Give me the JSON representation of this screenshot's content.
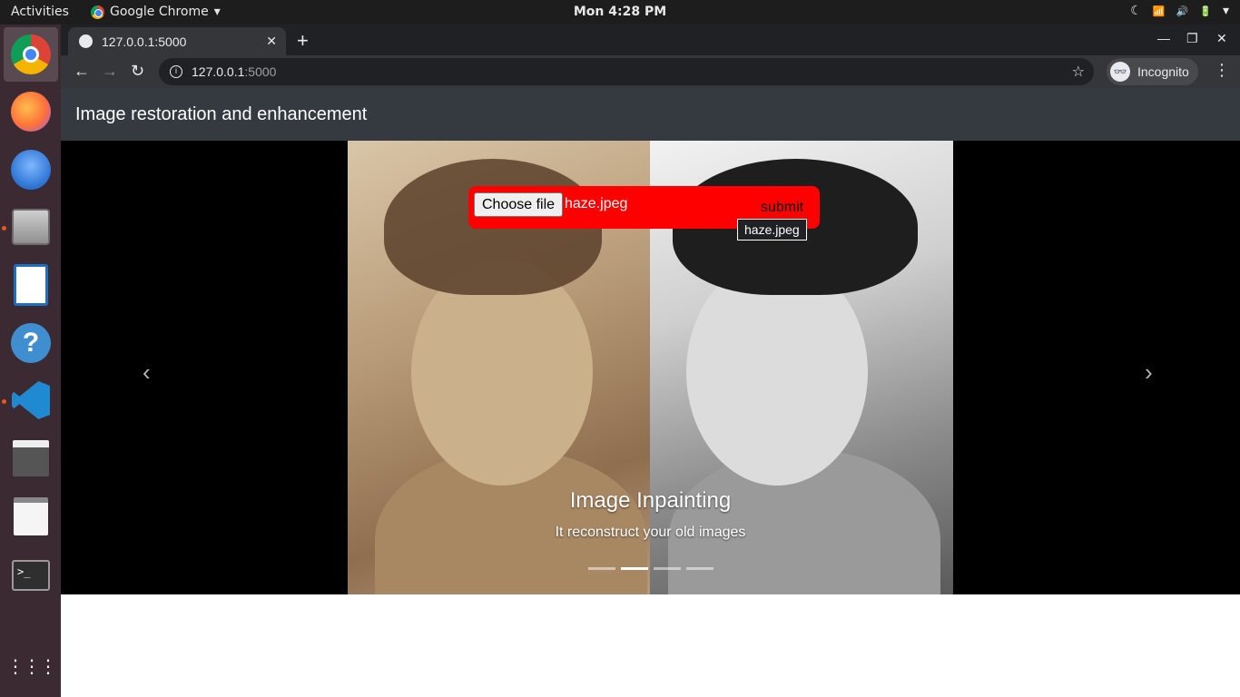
{
  "topbar": {
    "activities": "Activities",
    "app_name": "Google Chrome",
    "app_menu_arrow": "▾",
    "clock": "Mon  4:28 PM",
    "tray": {
      "night": "☾",
      "wifi": "📶",
      "volume": "🔊",
      "battery": "🔋",
      "menu": "▾"
    }
  },
  "dock": {
    "items": [
      {
        "name": "chrome",
        "color": "#4285f4"
      },
      {
        "name": "firefox",
        "color": "#ff7139"
      },
      {
        "name": "thunderbird",
        "color": "#2b73d2"
      },
      {
        "name": "files",
        "color": "#b8b8b8"
      },
      {
        "name": "writer",
        "color": "#1e6fc0"
      },
      {
        "name": "help",
        "color": "#3e8ed0"
      },
      {
        "name": "vscode",
        "color": "#1f8ad2"
      },
      {
        "name": "video-editor",
        "color": "#555555"
      },
      {
        "name": "text-editor",
        "color": "#f5f5f5"
      },
      {
        "name": "terminal",
        "color": "#2f2f2f"
      }
    ],
    "apps_grid": "⋮⋮⋮"
  },
  "browser": {
    "tab_title": "127.0.0.1:5000",
    "tab_close": "✕",
    "new_tab": "+",
    "win_min": "—",
    "win_max": "❐",
    "win_close": "✕",
    "back": "←",
    "forward": "→",
    "reload": "↻",
    "info": "i",
    "url_host": "127.0.0.1",
    "url_port": ":5000",
    "star": "☆",
    "incognito_icon": "👓",
    "incognito": "Incognito",
    "kebab": "⋮"
  },
  "page": {
    "brand": "Image restoration and enhancement",
    "form": {
      "choose_label": "Choose file",
      "file_name": "haze.jpeg",
      "submit_label": "submit",
      "tooltip": "haze.jpeg"
    },
    "slide": {
      "title": "Image Inpainting",
      "text": "It reconstruct your old images"
    },
    "indicators": [
      false,
      true,
      false,
      false
    ],
    "prev": "‹",
    "next": "›"
  }
}
